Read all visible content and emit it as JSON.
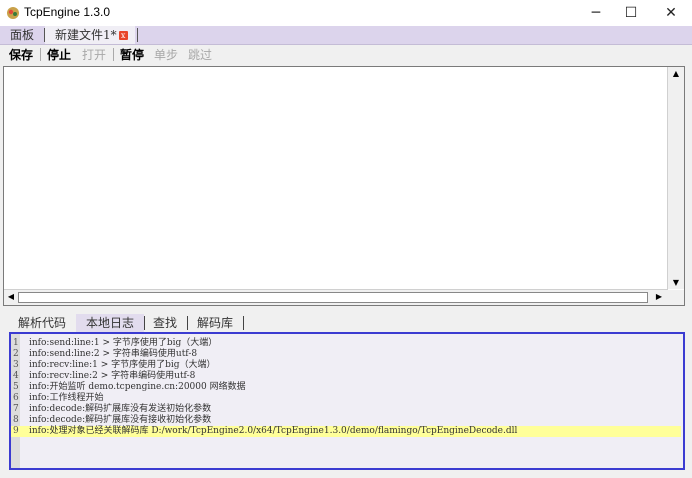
{
  "window": {
    "title": "TcpEngine 1.3.0",
    "minimize": "─",
    "maximize": "☐",
    "close": "✕"
  },
  "tabs": [
    {
      "label": "面板"
    },
    {
      "label": "新建文件1*",
      "close": "x"
    }
  ],
  "toolbar": {
    "save": "保存",
    "stop": "停止",
    "open": "打开",
    "pause": "暂停",
    "step": "单步",
    "skip": "跳过"
  },
  "bottom_tabs": [
    "解析代码",
    "本地日志",
    "查找",
    "解码库"
  ],
  "log": [
    {
      "n": "1",
      "text": "info:send:line:1 > 字节序使用了big（大端）"
    },
    {
      "n": "2",
      "text": "info:send:line:2 > 字符串编码使用utf-8"
    },
    {
      "n": "3",
      "text": "info:recv:line:1 > 字节序使用了big（大端）"
    },
    {
      "n": "4",
      "text": "info:recv:line:2 > 字符串编码使用utf-8"
    },
    {
      "n": "5",
      "text": "info:开始监听 demo.tcpengine.cn:20000 网络数据"
    },
    {
      "n": "6",
      "text": "info:工作线程开始"
    },
    {
      "n": "7",
      "text": "info:decode:解码扩展库没有发送初始化参数"
    },
    {
      "n": "8",
      "text": "info:decode:解码扩展库没有接收初始化参数"
    },
    {
      "n": "9",
      "text": "info:处理对象已经关联解码库 D:/work/TcpEngine2.0/x64/TcpEngine1.3.0/demo/flamingo/TcpEngineDecode.dll"
    }
  ]
}
